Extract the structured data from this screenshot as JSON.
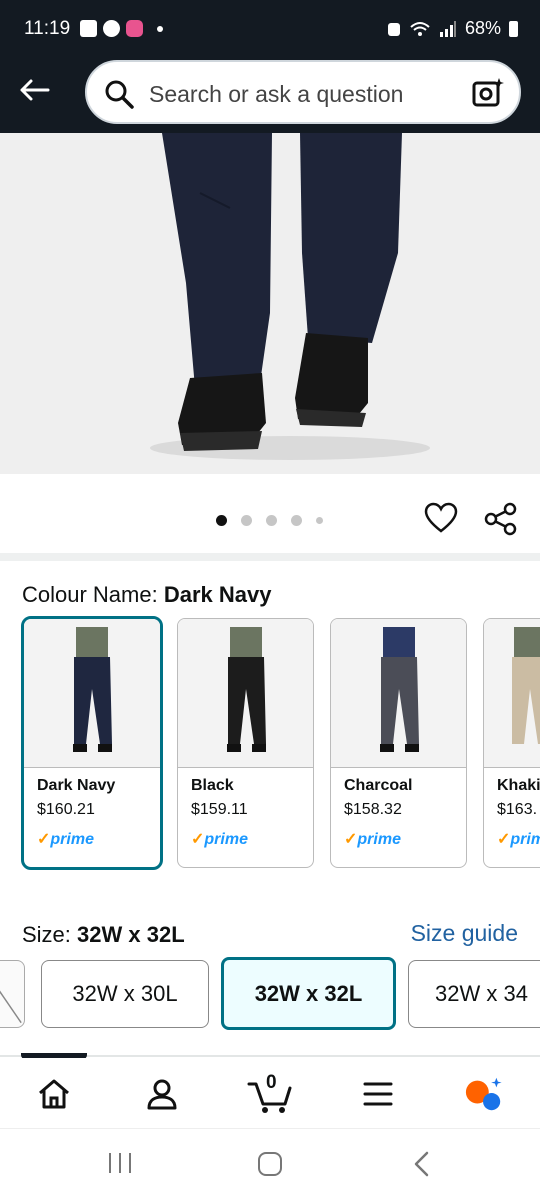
{
  "status_bar": {
    "time": "11:19",
    "battery": "68%"
  },
  "header": {
    "search_placeholder": "Search or ask a question"
  },
  "gallery": {
    "dots": 5,
    "active_index": 0
  },
  "colour": {
    "label": "Colour Name:",
    "selected": "Dark Navy",
    "options": [
      {
        "name": "Dark Navy",
        "price": "$160.21",
        "prime": "prime",
        "color": "#1f2740"
      },
      {
        "name": "Black",
        "price": "$159.11",
        "prime": "prime",
        "color": "#1c1c1c"
      },
      {
        "name": "Charcoal",
        "price": "$158.32",
        "prime": "prime",
        "color": "#4b4d57"
      },
      {
        "name": "Khaki",
        "price": "$163.",
        "prime": "prime",
        "color": "#cbbca3"
      }
    ]
  },
  "size": {
    "label": "Size:",
    "selected": "32W x 32L",
    "guide_link": "Size guide",
    "options": [
      "32W x 30L",
      "32W x 32L",
      "32W x 34"
    ]
  },
  "bottom_nav": {
    "cart_count": "0"
  },
  "colors": {
    "header_bg": "#131a22",
    "accent_teal": "#007185",
    "link_blue": "#2162a1",
    "prime_blue": "#1a98ff",
    "prime_check": "#ff9900"
  }
}
